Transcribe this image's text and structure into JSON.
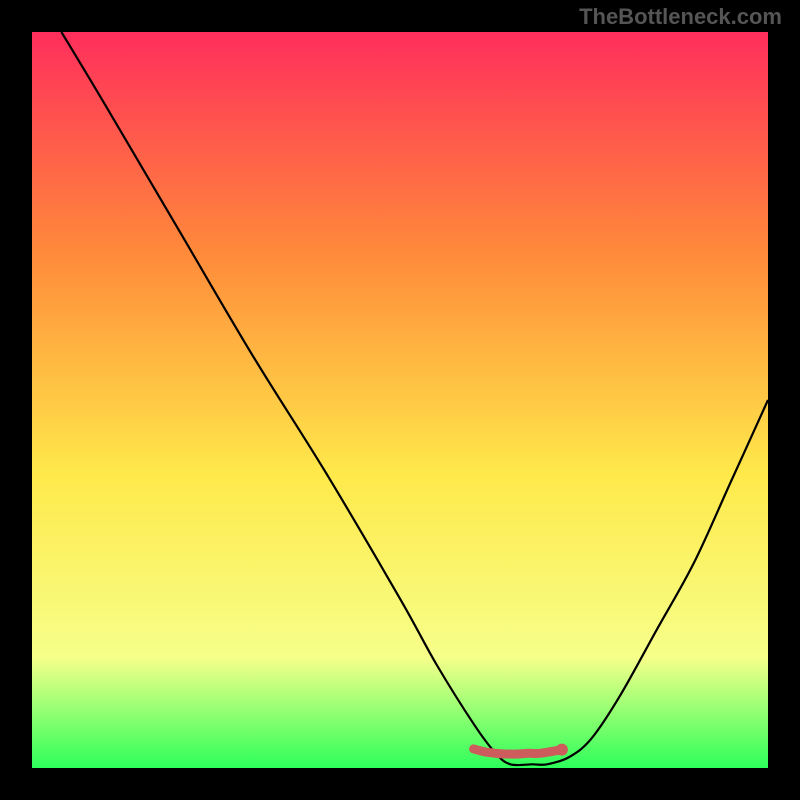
{
  "watermark": "TheBottleneck.com",
  "colors": {
    "gradient_top": "#ff2e5c",
    "gradient_mid_upper": "#ff8a3a",
    "gradient_mid": "#ffe94a",
    "gradient_lower": "#f6ff8a",
    "gradient_bottom": "#2dff5a",
    "curve": "#000000",
    "marker_fill": "#cd5c5c",
    "marker_stroke": "#cd5c5c"
  },
  "chart_data": {
    "type": "line",
    "title": "",
    "xlabel": "",
    "ylabel": "",
    "xlim": [
      0,
      100
    ],
    "ylim": [
      0,
      100
    ],
    "grid": false,
    "series": [
      {
        "name": "bottleneck_curve",
        "x": [
          4,
          10,
          20,
          30,
          40,
          50,
          55,
          60,
          63,
          65,
          68,
          70,
          73,
          76,
          80,
          85,
          90,
          95,
          100
        ],
        "y": [
          100,
          90,
          73,
          56,
          40,
          23,
          14,
          6,
          2,
          0.5,
          0.5,
          0.5,
          1.5,
          4,
          10,
          19,
          28,
          39,
          50
        ]
      }
    ],
    "markers": {
      "name": "highlight_segment",
      "x": [
        60,
        61.5,
        63,
        64.5,
        66,
        67.5,
        69,
        72
      ],
      "y": [
        2.6,
        2.2,
        2.0,
        1.9,
        1.9,
        2.0,
        2.0,
        2.5
      ]
    }
  }
}
